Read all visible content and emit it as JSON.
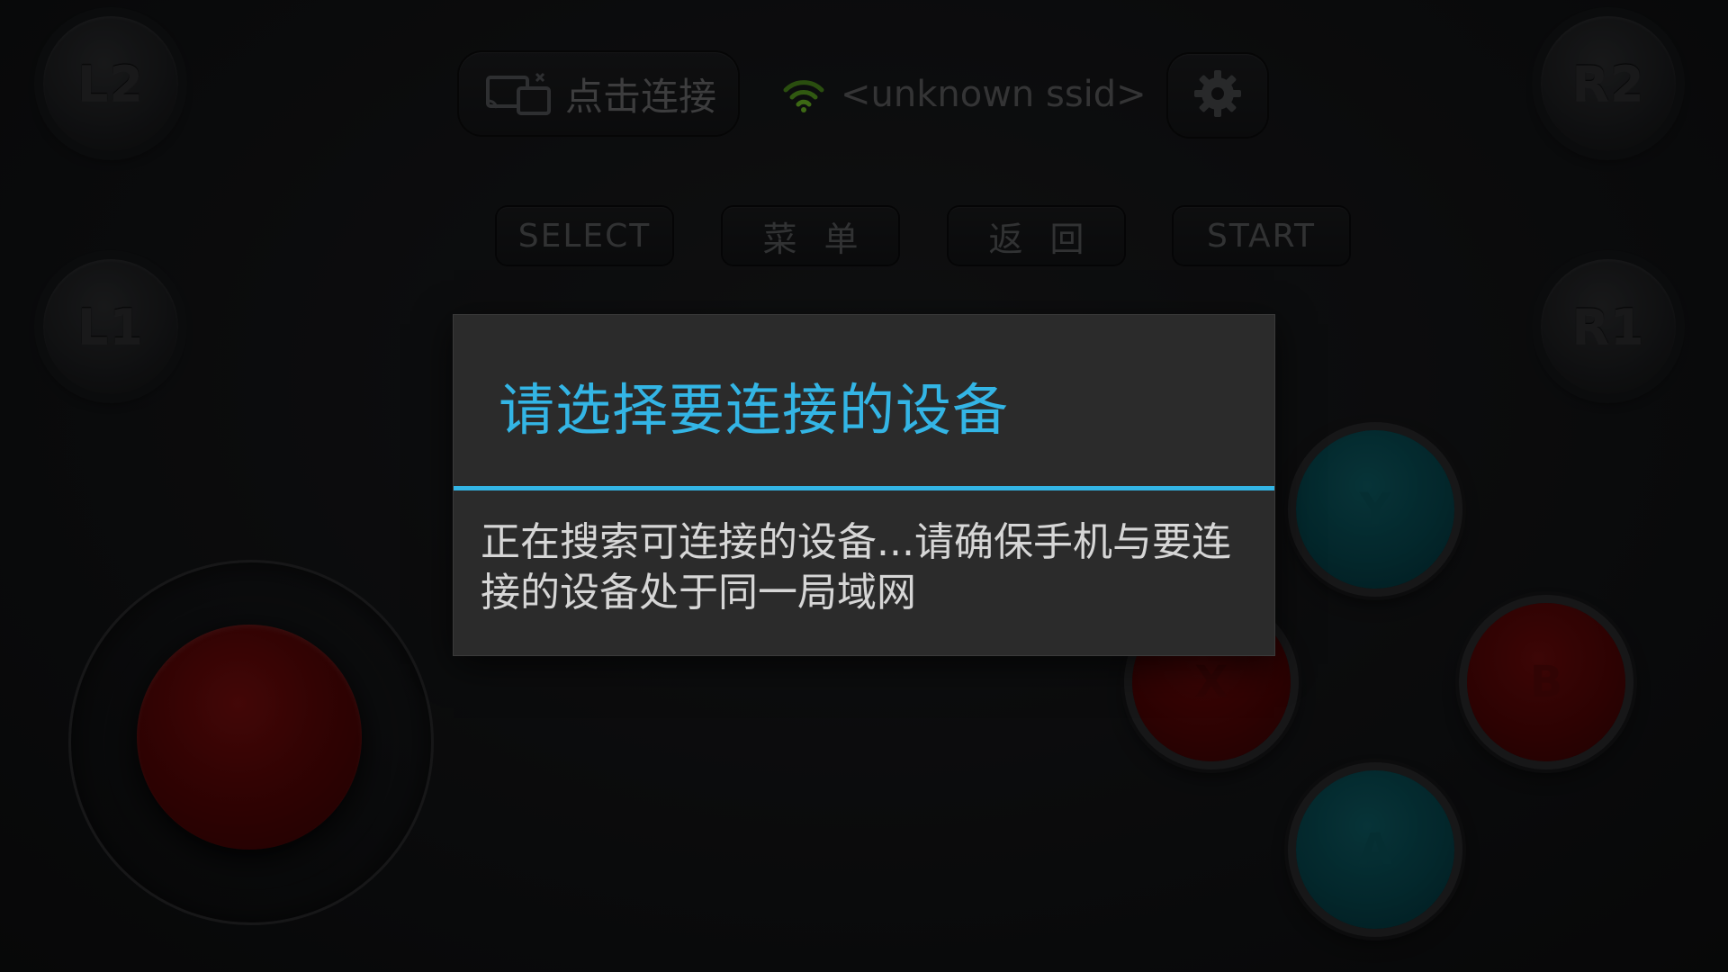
{
  "shoulders": {
    "l2": "L2",
    "r2": "R2",
    "l1": "L1",
    "r1": "R1"
  },
  "topbar": {
    "connect_label": "点击连接",
    "ssid": "<unknown ssid>",
    "wifi_color": "#6fbf26"
  },
  "function_buttons": {
    "select": "SELECT",
    "menu": "菜单",
    "back": "返回",
    "start": "START"
  },
  "action_buttons": {
    "y": "Y",
    "x": "X",
    "b": "B",
    "a": "A"
  },
  "dialog": {
    "title": "请选择要连接的设备",
    "message": "正在搜索可连接的设备...请确保手机与要连接的设备处于同一局域网",
    "accent_color": "#33b5e5"
  }
}
